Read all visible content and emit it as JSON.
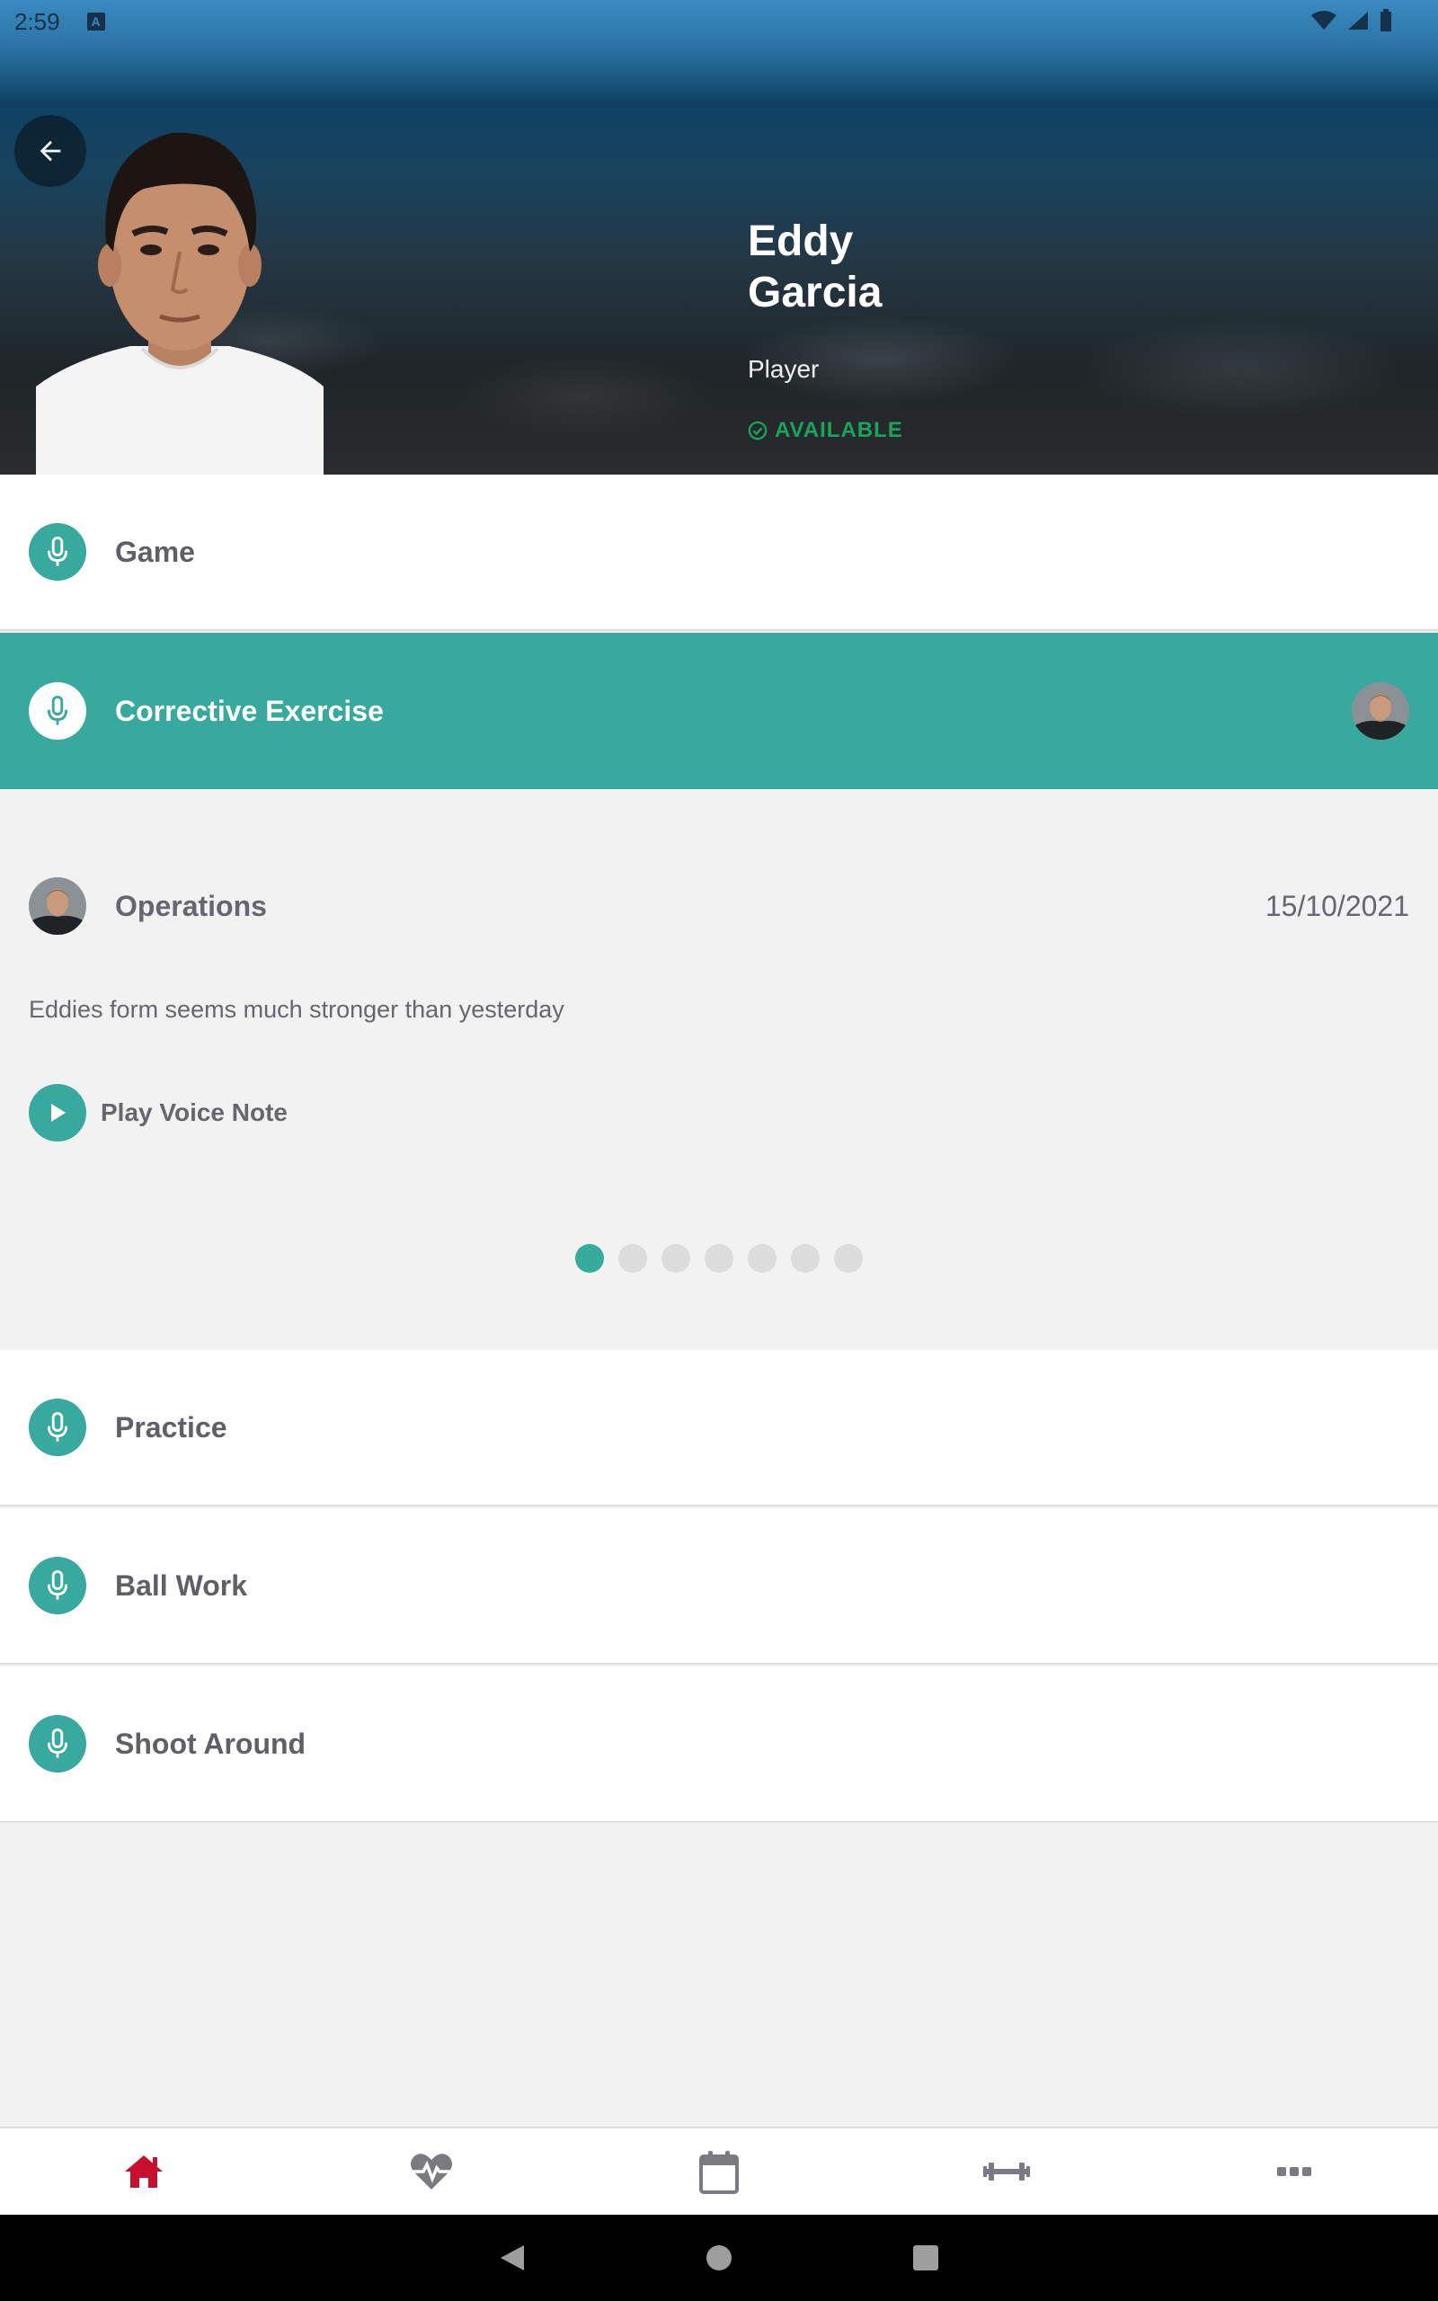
{
  "status_bar": {
    "time": "2:59",
    "badge": "A"
  },
  "player": {
    "first_name": "Eddy",
    "last_name": "Garcia",
    "role": "Player",
    "status": "AVAILABLE"
  },
  "sessions": [
    {
      "label": "Game",
      "active": false
    },
    {
      "label": "Corrective Exercise",
      "active": true
    },
    {
      "label": "Practice",
      "active": false
    },
    {
      "label": "Ball Work",
      "active": false
    },
    {
      "label": "Shoot Around",
      "active": false
    }
  ],
  "note": {
    "author": "Operations",
    "date": "15/10/2021",
    "text": "Eddies form seems much stronger than yesterday",
    "play_label": "Play Voice Note",
    "page_count": 7,
    "current_page": 1
  },
  "bottom_nav": [
    {
      "icon": "home-icon",
      "active": true
    },
    {
      "icon": "heart-pulse-icon",
      "active": false
    },
    {
      "icon": "calendar-icon",
      "active": false
    },
    {
      "icon": "dumbbell-icon",
      "active": false
    },
    {
      "icon": "more-icon",
      "active": false
    }
  ],
  "colors": {
    "accent": "#38a99d",
    "available": "#1aa35a",
    "nav_active": "#c8102e",
    "nav_inactive": "#7a7a80"
  }
}
